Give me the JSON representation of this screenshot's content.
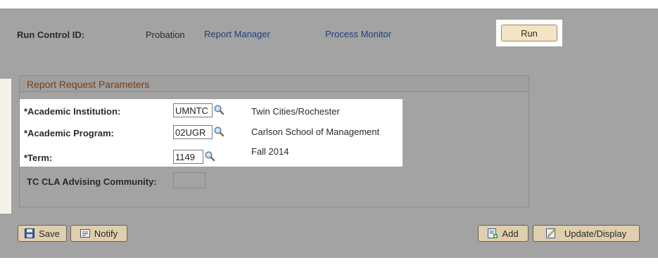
{
  "header": {
    "run_control_label": "Run Control ID:",
    "run_control_value": "Probation",
    "report_manager_link": "Report Manager",
    "process_monitor_link": "Process Monitor",
    "run_button": "Run"
  },
  "panel": {
    "title": "Report Request Parameters",
    "fields": {
      "institution": {
        "label": "*Academic Institution:",
        "value": "UMNTC",
        "description": "Twin Cities/Rochester"
      },
      "program": {
        "label": "*Academic Program:",
        "value": "02UGR",
        "description": "Carlson School of Management"
      },
      "term": {
        "label": "*Term:",
        "value": "1149",
        "description": "Fall 2014"
      },
      "advising": {
        "label": "TC CLA Advising Community:",
        "value": ""
      }
    }
  },
  "toolbar": {
    "save": "Save",
    "notify": "Notify",
    "add": "Add",
    "update_display": "Update/Display"
  },
  "icons": {
    "lookup": "magnifier-icon",
    "save": "floppy-disk-icon",
    "notify": "notify-icon",
    "add": "add-icon",
    "update": "update-display-icon"
  }
}
